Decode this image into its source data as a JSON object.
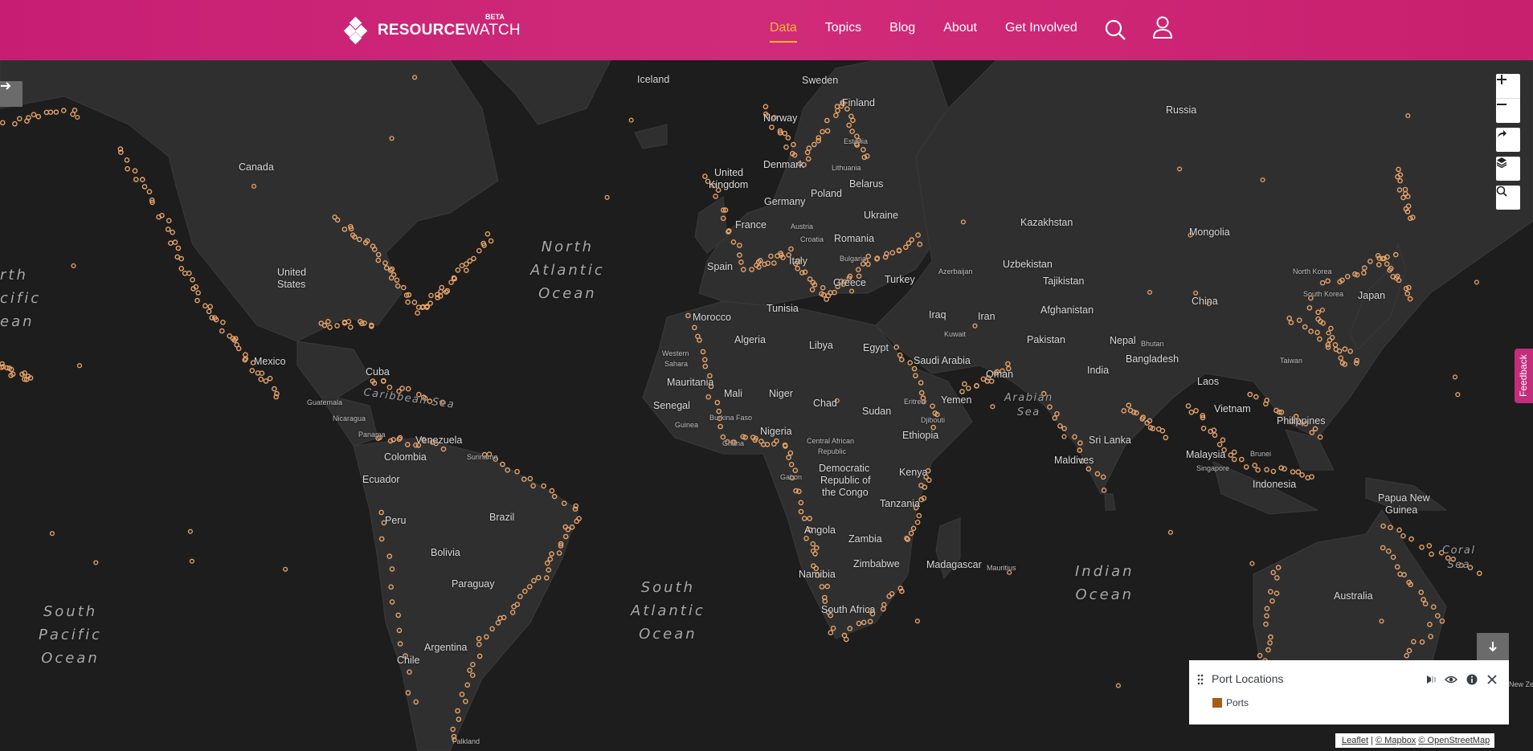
{
  "header": {
    "logo_bold": "RESOURCE",
    "logo_light": "WATCH",
    "logo_badge": "BETA",
    "nav": [
      {
        "label": "Data",
        "active": true
      },
      {
        "label": "Topics",
        "active": false
      },
      {
        "label": "Blog",
        "active": false
      },
      {
        "label": "About",
        "active": false
      },
      {
        "label": "Get Involved",
        "active": false
      }
    ],
    "icons": [
      "search-icon",
      "user-icon"
    ]
  },
  "map": {
    "labels": {
      "canada": "Canada",
      "usa_1": "United",
      "usa_2": "States",
      "mexico": "Mexico",
      "cuba": "Cuba",
      "guatemala": "Guatemala",
      "nicaragua": "Nicaragua",
      "panama": "Panama",
      "venezuela": "Venezuela",
      "suriname": "Suriname",
      "colombia": "Colombia",
      "ecuador": "Ecuador",
      "peru": "Peru",
      "brazil": "Brazil",
      "bolivia": "Bolivia",
      "paraguay": "Paraguay",
      "chile": "Chile",
      "argentina": "Argentina",
      "falkland": "Falkland",
      "iceland": "Iceland",
      "sweden": "Sweden",
      "finland": "Finland",
      "norway": "Norway",
      "estonia": "Estonia",
      "denmark": "Denmark",
      "lithuania": "Lithuania",
      "uk_1": "United",
      "uk_2": "Kingdom",
      "belarus": "Belarus",
      "germany": "Germany",
      "poland": "Poland",
      "ukraine": "Ukraine",
      "france": "France",
      "austria": "Austria",
      "croatia": "Croatia",
      "romania": "Romania",
      "bulgaria": "Bulgaria",
      "italy": "Italy",
      "spain": "Spain",
      "greece": "Greece",
      "turkey": "Turkey",
      "azerbaijan": "Azerbaijan",
      "morocco": "Morocco",
      "tunisia": "Tunisia",
      "algeria": "Algeria",
      "libya": "Libya",
      "egypt": "Egypt",
      "western_sahara_1": "Western",
      "western_sahara_2": "Sahara",
      "mauritania": "Mauritania",
      "mali": "Mali",
      "niger": "Niger",
      "chad": "Chad",
      "sudan": "Sudan",
      "eritrea": "Eritrea",
      "djibouti": "Djibouti",
      "senegal": "Senegal",
      "guinea": "Guinea",
      "burkina_faso": "Burkina Faso",
      "ghana": "Ghana",
      "nigeria": "Nigeria",
      "car_1": "Central African",
      "car_2": "Republic",
      "ethiopia": "Ethiopia",
      "gabon": "Gabon",
      "drc_1": "Democratic",
      "drc_2": "Republic of",
      "drc_3": "the Congo",
      "kenya": "Kenya",
      "tanzania": "Tanzania",
      "angola": "Angola",
      "zambia": "Zambia",
      "zimbabwe": "Zimbabwe",
      "namibia": "Namibia",
      "madagascar": "Madagascar",
      "mauritius": "Mauritius",
      "south_africa": "South Africa",
      "russia": "Russia",
      "kazakhstan": "Kazakhstan",
      "mongolia": "Mongolia",
      "uzbekistan": "Uzbekistan",
      "tajikistan": "Tajikistan",
      "iraq": "Iraq",
      "iran": "Iran",
      "afghanistan": "Afghanistan",
      "kuwait": "Kuwait",
      "saudi_arabia": "Saudi Arabia",
      "yemen": "Yemen",
      "oman": "Oman",
      "pakistan": "Pakistan",
      "nepal": "Nepal",
      "bhutan": "Bhutan",
      "india": "India",
      "bangladesh": "Bangladesh",
      "china": "China",
      "north_korea": "North Korea",
      "south_korea": "South Korea",
      "japan": "Japan",
      "taiwan": "Taiwan",
      "laos": "Laos",
      "vietnam": "Vietnam",
      "philippines": "Philippines",
      "malaysia": "Malaysia",
      "brunei": "Brunei",
      "singapore": "Singapore",
      "indonesia": "Indonesia",
      "sri_lanka": "Sri Lanka",
      "maldives": "Maldives",
      "png_1": "Papua New",
      "png_2": "Guinea",
      "australia": "Australia",
      "new_zealand": "New Zea"
    },
    "oceans": {
      "north_atlantic": "North\nAtlantic\nOcean",
      "south_atlantic": "South\nAtlantic\nOcean",
      "south_pacific": "South\nPacific\nOcean",
      "north_pacific": "rth\ncific\nean",
      "indian": "Indian\nOcean",
      "arabian_sea": "Arabian\nSea",
      "caribbean_sea": "Caribbean Sea",
      "coral_sea": "Coral\nSea"
    },
    "controls": [
      "zoom-in-icon",
      "zoom-out-icon",
      "share-icon",
      "layers-icon",
      "search-icon"
    ],
    "feedback_label": "Feedback"
  },
  "legend": {
    "title": "Port Locations",
    "item_label": "Ports",
    "swatch_color": "#a65c17"
  },
  "attribution": {
    "leaflet": "Leaflet",
    "sep": " | ",
    "mapbox": "© Mapbox",
    "osm": "© OpenStreetMap"
  },
  "colors": {
    "header": "#c71e73",
    "nav_active": "#fab72e",
    "land": "#2e2e2e",
    "water": "#1c1c1c",
    "port_marker": "#e8a46a"
  }
}
